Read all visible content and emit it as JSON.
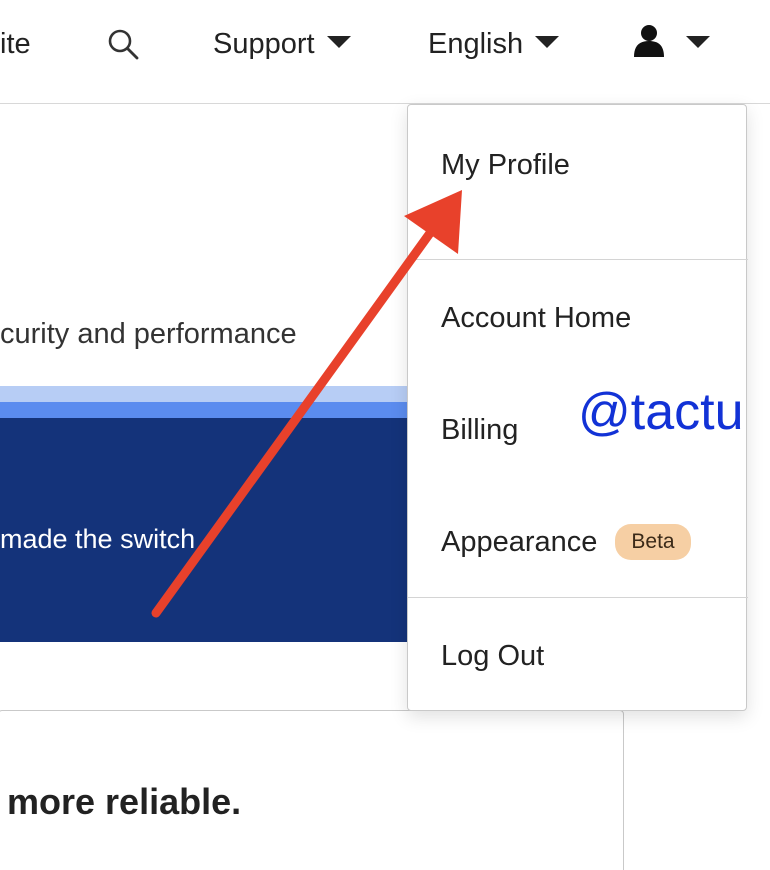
{
  "nav": {
    "site_label": "ite",
    "search_icon": "search-icon",
    "support_label": "Support",
    "language_label": "English",
    "user_icon": "user-icon"
  },
  "content": {
    "hero_text": "curity and performance",
    "banner_text": "made the switch",
    "card_heading": "more reliable."
  },
  "dropdown": {
    "items": [
      {
        "label": "My Profile"
      },
      {
        "label": "Account Home"
      },
      {
        "label": "Billing"
      },
      {
        "label": "Appearance",
        "badge": "Beta"
      },
      {
        "label": "Log Out"
      }
    ]
  },
  "annotation": {
    "watermark": "@tactu",
    "arrow_color": "#e8412b"
  },
  "colors": {
    "banner": "#14337a",
    "band_light": "#b7cdf5",
    "band_mid": "#5b8cef",
    "badge_bg": "#f6cfa4",
    "watermark": "#1232d6"
  }
}
